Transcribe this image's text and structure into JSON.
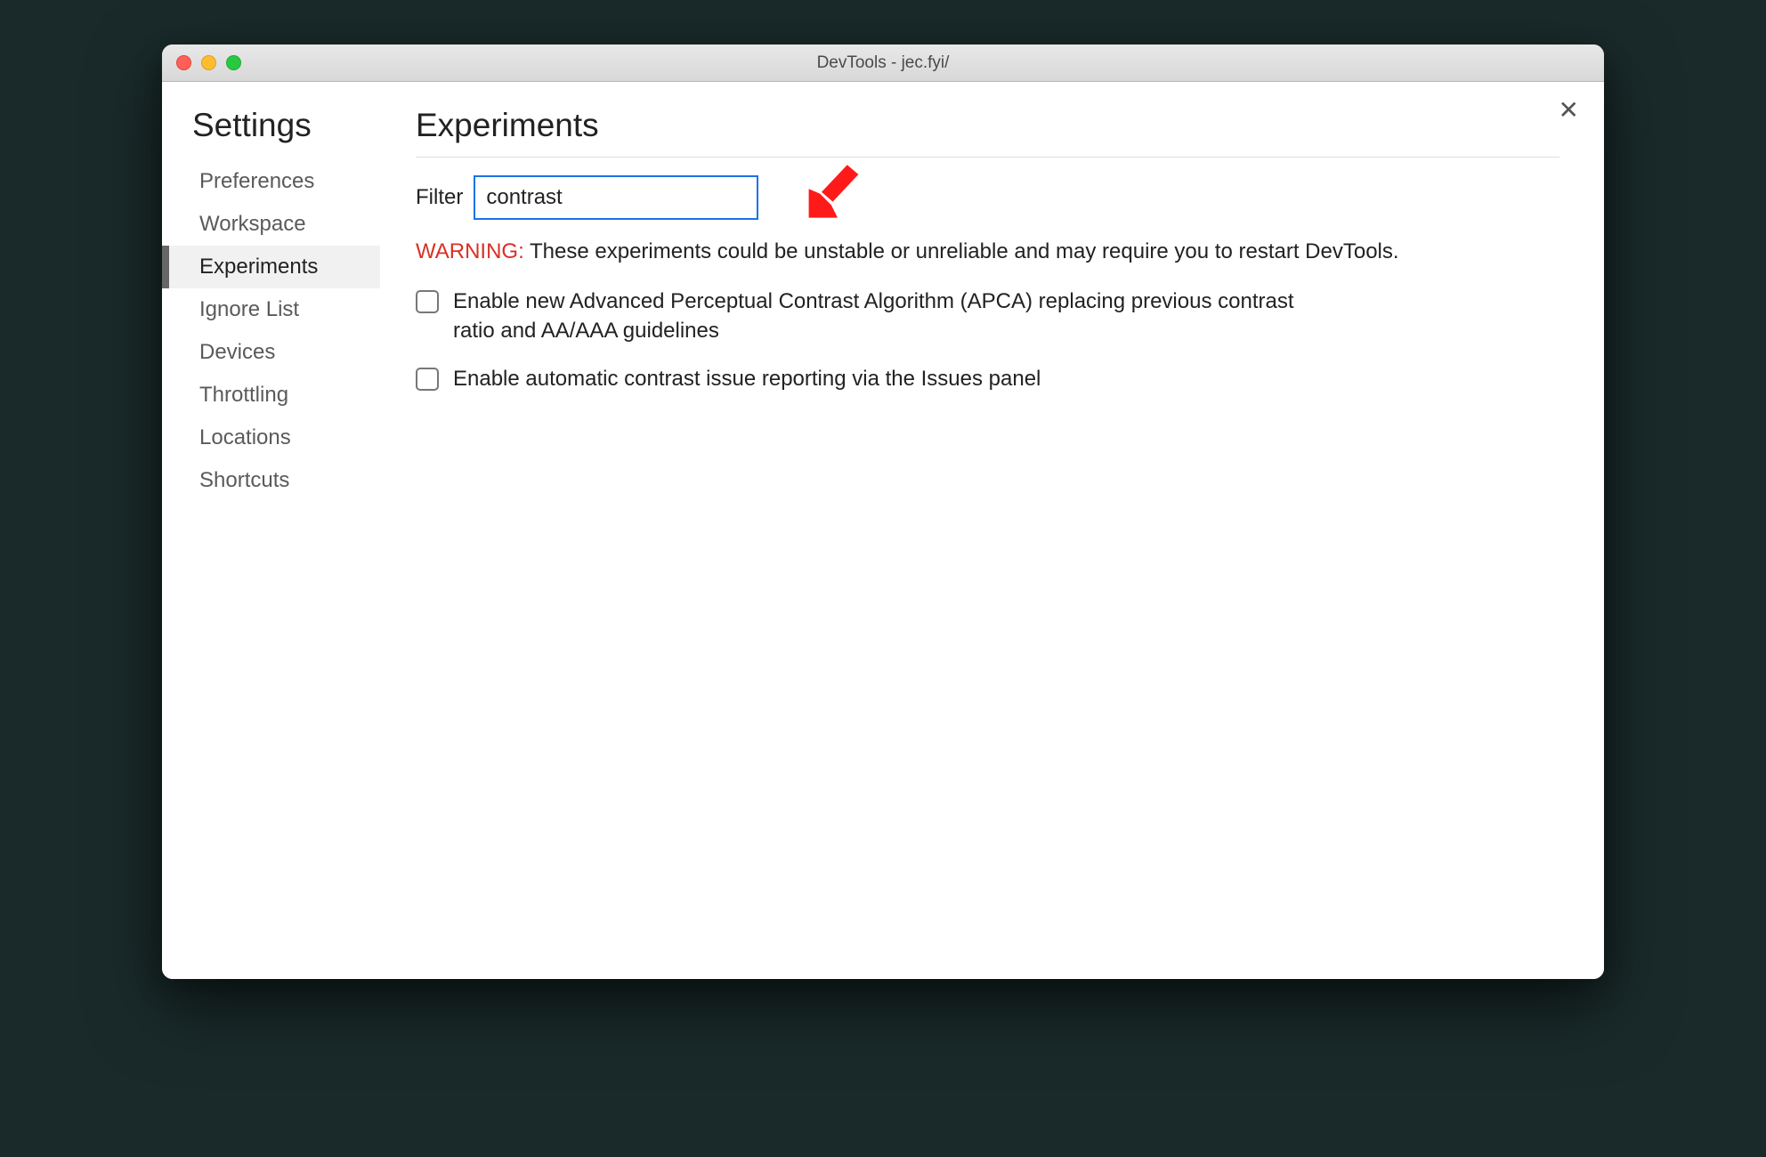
{
  "window": {
    "title": "DevTools - jec.fyi/"
  },
  "sidebar": {
    "title": "Settings",
    "items": [
      {
        "label": "Preferences",
        "active": false
      },
      {
        "label": "Workspace",
        "active": false
      },
      {
        "label": "Experiments",
        "active": true
      },
      {
        "label": "Ignore List",
        "active": false
      },
      {
        "label": "Devices",
        "active": false
      },
      {
        "label": "Throttling",
        "active": false
      },
      {
        "label": "Locations",
        "active": false
      },
      {
        "label": "Shortcuts",
        "active": false
      }
    ]
  },
  "main": {
    "page_title": "Experiments",
    "filter_label": "Filter",
    "filter_value": "contrast",
    "warning_label": "WARNING:",
    "warning_text": " These experiments could be unstable or unreliable and may require you to restart DevTools.",
    "experiments": [
      {
        "label": "Enable new Advanced Perceptual Contrast Algorithm (APCA) replacing previous contrast ratio and AA/AAA guidelines",
        "checked": false
      },
      {
        "label": "Enable automatic contrast issue reporting via the Issues panel",
        "checked": false
      }
    ]
  },
  "annotation": {
    "arrow_color": "#ff1a1a"
  }
}
